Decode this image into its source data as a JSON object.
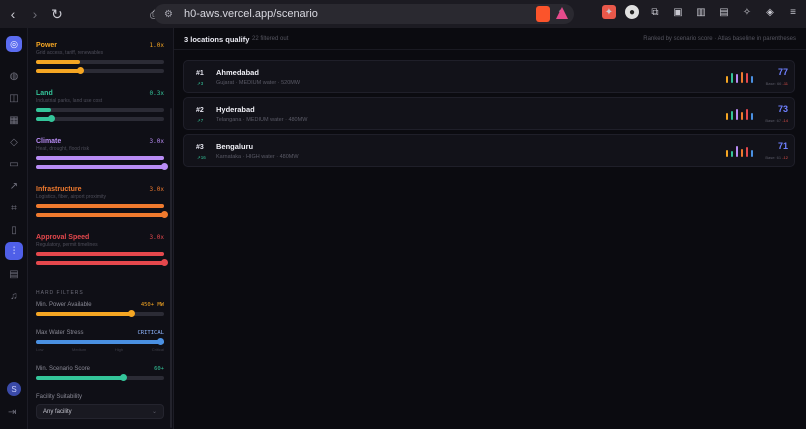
{
  "browser": {
    "url": "h0-aws.vercel.app/scenario"
  },
  "rail": {
    "avatar_initial": "S"
  },
  "weights": [
    {
      "name": "Power",
      "value_label": "1.0x",
      "desc": "Grid access, tariff, renewables",
      "level": 0.34,
      "color": "#f5a623",
      "track_fill_color": "#f5a623"
    },
    {
      "name": "Land",
      "value_label": "0.3x",
      "desc": "Industrial parks, land use cost",
      "level": 0.12,
      "color": "#34c59a",
      "track_fill_color": "#34c59a"
    },
    {
      "name": "Climate",
      "value_label": "3.0x",
      "desc": "Heat, drought, flood risk",
      "level": 1.0,
      "color": "#b98cf5",
      "track_fill_color": "#b98cf5"
    },
    {
      "name": "Infrastructure",
      "value_label": "3.0x",
      "desc": "Logistics, fiber, airport proximity",
      "level": 1.0,
      "color": "#f07a2e",
      "track_fill_color": "#f07a2e"
    },
    {
      "name": "Approval Speed",
      "value_label": "3.0x",
      "desc": "Regulatory, permit timelines",
      "level": 1.0,
      "color": "#e5484d",
      "track_fill_color": "#e5484d"
    }
  ],
  "hard_filters": {
    "title": "HARD FILTERS",
    "items": [
      {
        "name": "Min. Power Available",
        "value_label": "450+ MW",
        "level": 0.74,
        "color": "#f5a623",
        "value_color": "#f5a623"
      },
      {
        "name": "Max Water Stress",
        "value_label": "CRITICAL",
        "level": 1.0,
        "color": "#4a90e2",
        "value_color": "#8fb6ff",
        "ticks": [
          "Low",
          "Medium",
          "High",
          "Critical"
        ]
      },
      {
        "name": "Min. Scenario Score",
        "value_label": "60+",
        "level": 0.68,
        "color": "#34c59a",
        "value_color": "#34c59a"
      }
    ],
    "facility_label": "Facility Suitability",
    "facility_value": "Any facility"
  },
  "results": {
    "count_label": "3 locations qualify",
    "filtered_label": "22 filtered out",
    "ranked_label": "Ranked by scenario score · Atlas baseline in parentheses",
    "items": [
      {
        "rank": "#1",
        "delta": "↗3",
        "city": "Ahmedabad",
        "meta": "Gujarat · MEDIUM water · 520MW",
        "score": "77",
        "base": "Base: 66 ",
        "base_delta": "-11",
        "bars": [
          0.62,
          0.85,
          0.72,
          0.95,
          0.8,
          0.55
        ],
        "bar_colors": [
          "#f5a623",
          "#34c59a",
          "#b98cf5",
          "#f07a2e",
          "#e5484d",
          "#4a90e2"
        ]
      },
      {
        "rank": "#2",
        "delta": "↗7",
        "city": "Hyderabad",
        "meta": "Telangana · MEDIUM water · 480MW",
        "score": "73",
        "base": "Base: 67 ",
        "base_delta": "-14",
        "bars": [
          0.55,
          0.78,
          0.9,
          0.66,
          0.88,
          0.6
        ],
        "bar_colors": [
          "#f5a623",
          "#34c59a",
          "#b98cf5",
          "#f07a2e",
          "#e5484d",
          "#4a90e2"
        ]
      },
      {
        "rank": "#3",
        "delta": "↗16",
        "city": "Bengaluru",
        "meta": "Karnataka · HIGH water · 480MW",
        "score": "71",
        "base": "Base: 61 ",
        "base_delta": "-12",
        "bars": [
          0.6,
          0.5,
          0.95,
          0.7,
          0.82,
          0.58
        ],
        "bar_colors": [
          "#f5a623",
          "#34c59a",
          "#b98cf5",
          "#f07a2e",
          "#e5484d",
          "#4a90e2"
        ]
      }
    ]
  }
}
